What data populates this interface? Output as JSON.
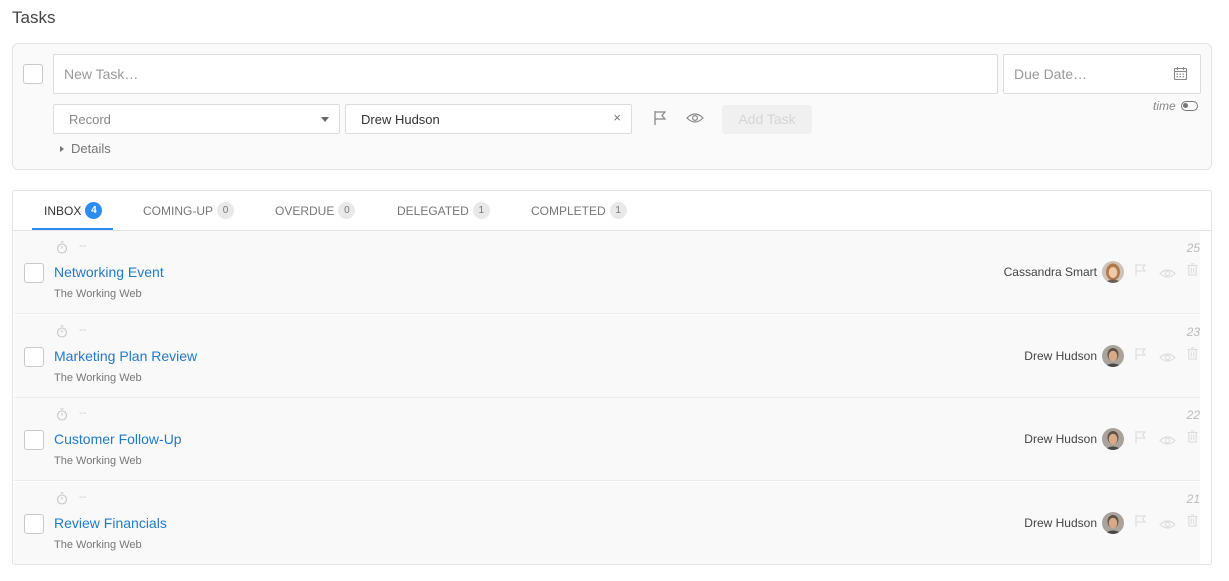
{
  "page": {
    "title": "Tasks"
  },
  "new_task": {
    "task_placeholder": "New Task…",
    "due_date_placeholder": "Due Date…",
    "record_placeholder": "Record",
    "assignee": "Drew Hudson",
    "clear_symbol": "×",
    "add_button": "Add Task",
    "time_label": "time",
    "details_label": "Details"
  },
  "tabs": [
    {
      "label": "INBOX",
      "count": "4",
      "active": true
    },
    {
      "label": "COMING-UP",
      "count": "0",
      "active": false
    },
    {
      "label": "OVERDUE",
      "count": "0",
      "active": false
    },
    {
      "label": "DELEGATED",
      "count": "1",
      "active": false
    },
    {
      "label": "COMPLETED",
      "count": "1",
      "active": false
    }
  ],
  "tasks": [
    {
      "dash": "--",
      "title": "Networking Event",
      "subtitle": "The Working Web",
      "number": "25",
      "assignee": "Cassandra Smart",
      "avatar": "female"
    },
    {
      "dash": "--",
      "title": "Marketing Plan Review",
      "subtitle": "The Working Web",
      "number": "23",
      "assignee": "Drew Hudson",
      "avatar": "male"
    },
    {
      "dash": "--",
      "title": "Customer Follow-Up",
      "subtitle": "The Working Web",
      "number": "22",
      "assignee": "Drew Hudson",
      "avatar": "male"
    },
    {
      "dash": "--",
      "title": "Review Financials",
      "subtitle": "The Working Web",
      "number": "21",
      "assignee": "Drew Hudson",
      "avatar": "male"
    }
  ],
  "colors": {
    "accent": "#2d8cf0",
    "link": "#2379c7",
    "row_background": "#f9f9f9"
  },
  "icons": [
    "calendar-icon",
    "flag-icon",
    "eye-icon",
    "timer-icon",
    "trash-icon",
    "toggle-icon"
  ]
}
